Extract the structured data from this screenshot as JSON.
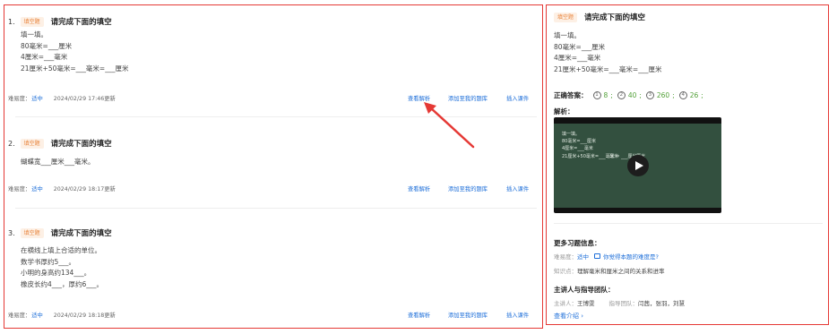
{
  "questions": [
    {
      "num": "1.",
      "badge": "填空题",
      "title": "请完成下面的填空",
      "lines": [
        "填一填。",
        "80毫米=___厘米",
        "4厘米=___毫米",
        "21厘米+50毫米=___毫米=___厘米"
      ],
      "difficulty_label": "难易度：",
      "difficulty_value": "适中",
      "date": "2024/02/29 17:46更新",
      "actions": [
        "查看解析",
        "添加至我的题库",
        "插入课件"
      ]
    },
    {
      "num": "2.",
      "badge": "填空题",
      "title": "请完成下面的填空",
      "lines": [
        "蝴蝶宽___厘米___毫米。"
      ],
      "difficulty_label": "难易度：",
      "difficulty_value": "适中",
      "date": "2024/02/29 18:17更新",
      "actions": [
        "查看解析",
        "添加至我的题库",
        "插入课件"
      ]
    },
    {
      "num": "3.",
      "badge": "填空题",
      "title": "请完成下面的填空",
      "lines": [
        "在横线上填上合适的单位。",
        "数学书厚约5___。",
        "小明的身高约134___。",
        "橡皮长约4___，厚约6___。"
      ],
      "difficulty_label": "难易度：",
      "difficulty_value": "适中",
      "date": "2024/02/29 18:18更新",
      "actions": [
        "查看解析",
        "添加至我的题库",
        "插入课件"
      ]
    }
  ],
  "detail": {
    "badge": "填空题",
    "title": "请完成下面的填空",
    "lines": [
      "填一填。",
      "80毫米=___厘米",
      "4厘米=___毫米",
      "21厘米+50毫米=___毫米=___厘米"
    ],
    "answer_label": "正确答案：",
    "answers": [
      {
        "mark": "1",
        "value": "8"
      },
      {
        "mark": "2",
        "value": "40"
      },
      {
        "mark": "3",
        "value": "260"
      },
      {
        "mark": "4",
        "value": "26"
      }
    ],
    "analysis_label": "解析：",
    "video_board_lines": [
      "填一填。",
      "80毫米=___厘米",
      "4厘米=___毫米",
      "21厘米+50毫米=___毫米 = ___厘米"
    ],
    "video_board_notes": [
      "毫米",
      "厘米"
    ],
    "more_info_title": "更多习题信息：",
    "difficulty_label": "难易度：",
    "difficulty_value": "适中",
    "feedback_text": "你觉得本题的难度是?",
    "knowledge_label": "知识点：",
    "knowledge_value": "理解毫米和厘米之间的关系和进率",
    "team_title": "主讲人与指导团队：",
    "speaker_label": "主讲人：",
    "speaker_value": "王博雯",
    "guide_label": "指导团队：",
    "guide_value": "闫茜，张羽，刘慧",
    "more_link": "查看介绍 ›"
  },
  "colors": {
    "border": "#e53935",
    "link": "#1e6fd9",
    "answer": "#52a038",
    "badge_text": "#e8833a",
    "arrow": "#e53935"
  }
}
